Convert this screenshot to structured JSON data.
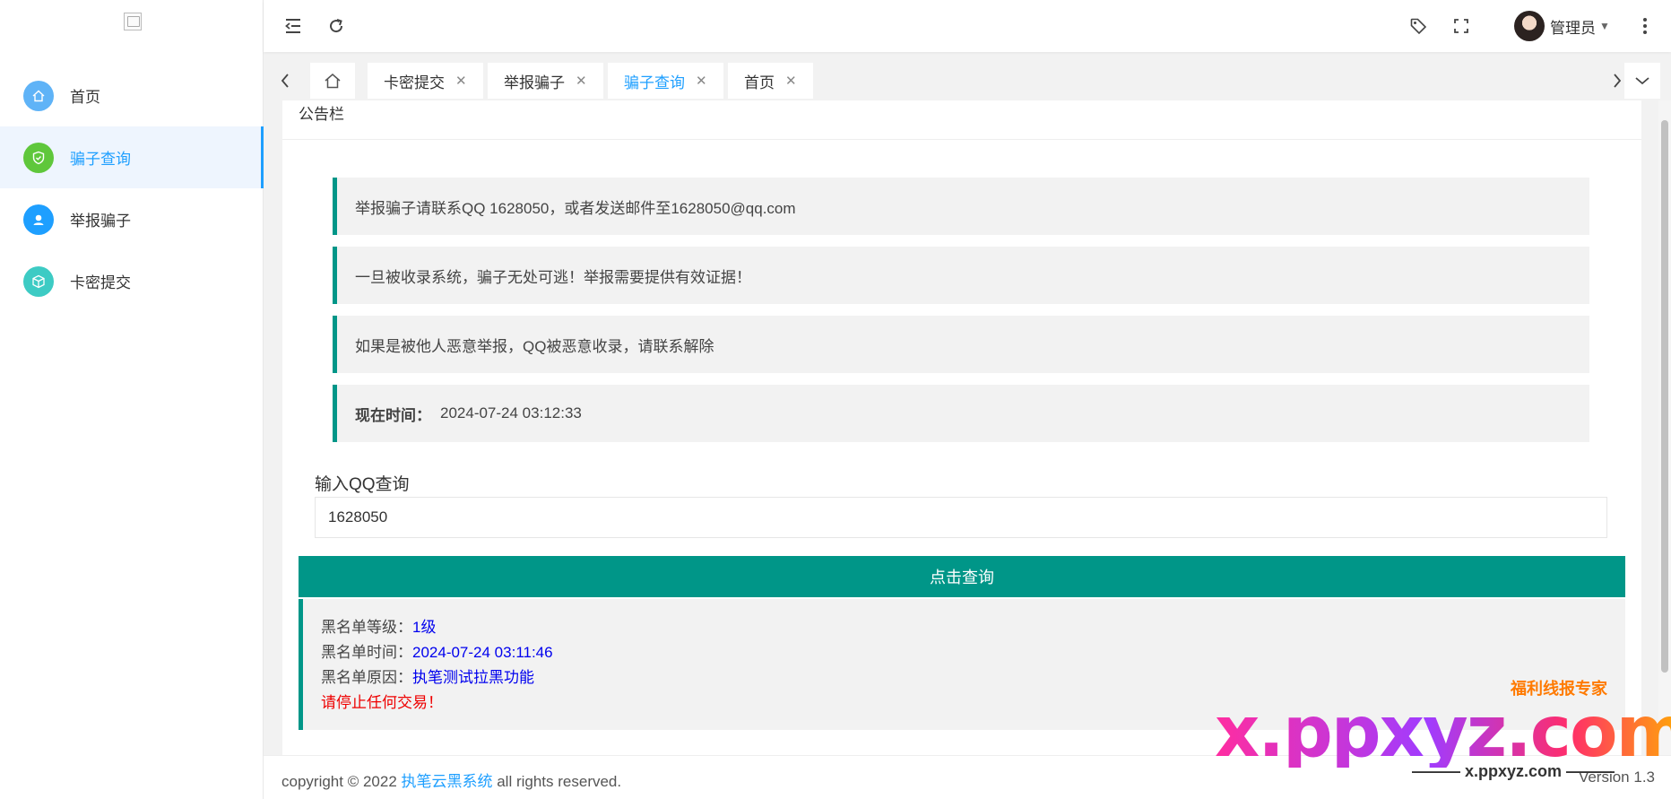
{
  "sidebar": {
    "items": [
      {
        "label": "首页",
        "icon": "home-icon",
        "color": "#5fb3f7"
      },
      {
        "label": "骗子查询",
        "icon": "shield-check-icon",
        "color": "#5fc73b"
      },
      {
        "label": "举报骗子",
        "icon": "user-report-icon",
        "color": "#1e9fff"
      },
      {
        "label": "卡密提交",
        "icon": "cube-icon",
        "color": "#3dcbc4"
      }
    ]
  },
  "header": {
    "user_name": "管理员"
  },
  "tabs": [
    {
      "label": "卡密提交"
    },
    {
      "label": "举报骗子"
    },
    {
      "label": "骗子查询"
    },
    {
      "label": "首页"
    }
  ],
  "card": {
    "title": "公告栏",
    "notices": [
      "举报骗子请联系QQ 1628050，或者发送邮件至1628050@qq.com",
      "一旦被收录系统，骗子无处可逃！举报需要提供有效证据！",
      "如果是被他人恶意举报，QQ被恶意收录，请联系解除"
    ],
    "time_label": "现在时间：",
    "time_value": "2024-07-24 03:12:33",
    "query_label": "输入QQ查询",
    "query_value": "1628050",
    "query_button": "点击查询"
  },
  "result": {
    "level_label": "黑名单等级：",
    "level_value": "1级",
    "time_label": "黑名单时间：",
    "time_value": "2024-07-24 03:11:46",
    "reason_label": "黑名单原因：",
    "reason_value": "执笔测试拉黑功能",
    "warning": "请停止任何交易！"
  },
  "footer": {
    "copyright_prefix": "copyright © 2022 ",
    "brand": "执笔云黑系统",
    "copyright_suffix": " all rights reserved.",
    "version": "Version 1.3"
  },
  "watermark": {
    "main": "x.ppxyz.com",
    "sub": "——— x.ppxyz.com ———",
    "badge": "福利线报专家"
  },
  "colors": {
    "accent": "#009688",
    "link": "#1e9fff",
    "result_value": "#0000ee",
    "warning": "#ee0000"
  }
}
